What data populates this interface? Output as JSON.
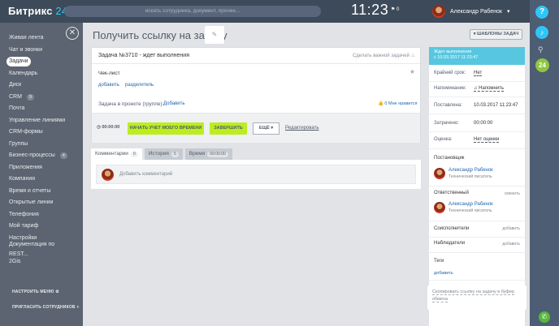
{
  "header": {
    "logo_main": "Битрикс",
    "logo_num": "24",
    "search_placeholder": "искать сотрудника, документ, прочее...",
    "clock": "11:23",
    "flag_count": "0",
    "user_name": "Александр Рабенок"
  },
  "sidebar": {
    "items": [
      {
        "label": "Живая лента"
      },
      {
        "label": "Чат и звонки"
      },
      {
        "label": "Задачи",
        "active": true
      },
      {
        "label": "Календарь"
      },
      {
        "label": "Диск"
      },
      {
        "label": "CRM",
        "count": "9"
      },
      {
        "label": "Почта"
      },
      {
        "label": "Управление линиями"
      },
      {
        "label": "CRM-формы"
      },
      {
        "label": "Группы"
      },
      {
        "label": "Бизнес-процессы",
        "count": "4"
      },
      {
        "label": "Приложения"
      },
      {
        "label": "Компания"
      },
      {
        "label": "Время и отчеты"
      },
      {
        "label": "Открытые линии"
      },
      {
        "label": "Телефония"
      },
      {
        "label": "Мой тариф"
      },
      {
        "label": "Настройки"
      },
      {
        "label": "Документация по REST..."
      },
      {
        "label": "2Gis"
      }
    ],
    "setup_menu": "НАСТРОИТЬ МЕНЮ",
    "invite": "ПРИГЛАСИТЬ СОТРУДНИКОВ"
  },
  "page": {
    "title": "Получить ссылку на задачу",
    "templates_button": "ШАБЛОНЫ ЗАДАЧ"
  },
  "task": {
    "header": "Задача №3710 - ждет выполнения",
    "make_important": "Сделать важной задачей",
    "checklist": "Чек-лист",
    "add": "добавить",
    "separator": "разделитель",
    "project_label": "Задача в проекте (группе):",
    "project_add": "Добавить",
    "likes": "0",
    "like_text": "Мне нравится",
    "timer": "00:00:00",
    "start_button": "НАЧАТЬ УЧЕТ МОЕГО ВРЕМЕНИ",
    "finish_button": "ЗАВЕРШИТЬ",
    "more_button": "ЕЩЁ",
    "edit_link": "Редактировать"
  },
  "tabs": [
    {
      "label": "Комментарии",
      "badge": "0"
    },
    {
      "label": "История",
      "badge": "5"
    },
    {
      "label": "Время",
      "badge": "00:00:00"
    }
  ],
  "comment": {
    "placeholder": "Добавить комментарий"
  },
  "right": {
    "status": "Ждет выполнения",
    "since": "с 10.03.2017 11:23:47",
    "deadline_label": "Крайний срок:",
    "deadline_value": "Нет",
    "reminder_label": "Напоминание:",
    "reminder_value": "Напомнить",
    "created_label": "Поставлена:",
    "created_value": "10.03.2017 11:23:47",
    "spent_label": "Затрачено:",
    "spent_value": "00:00:00",
    "rating_label": "Оценка:",
    "rating_value": "Нет оценки",
    "creator_title": "Постановщик",
    "creator_name": "Александр Рабенок",
    "creator_position": "Технический писатель",
    "responsible_title": "Ответственный",
    "change": "сменить",
    "responsible_name": "Александр Рабенок",
    "responsible_position": "Технический писатель",
    "coexec_title": "Соисполнители",
    "add": "добавить",
    "observers_title": "Наблюдатели",
    "tags_title": "Теги",
    "tags_add": "добавить",
    "copy_link": "Скопировать ссылку на задачу в буфер обмена"
  }
}
